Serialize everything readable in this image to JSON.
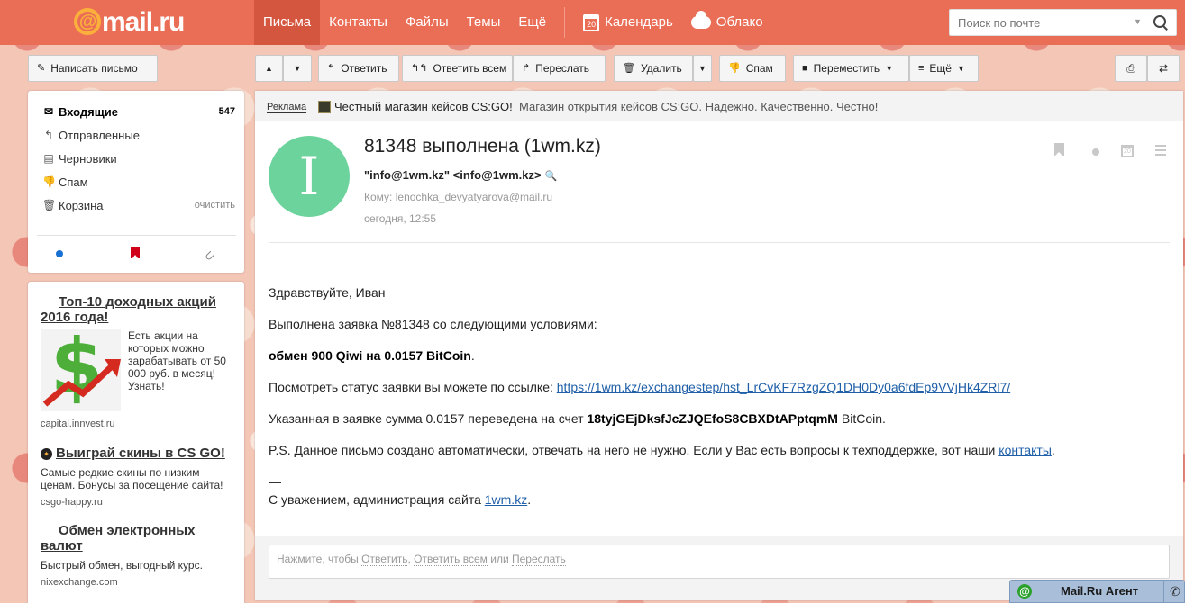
{
  "header": {
    "logo": "mail.ru",
    "nav": [
      "Письма",
      "Контакты",
      "Файлы",
      "Темы",
      "Ещё"
    ],
    "calendar": "Календарь",
    "calendar_day": "20",
    "cloud": "Облако",
    "search_placeholder": "Поиск по почте"
  },
  "toolbar": {
    "compose": "Написать письмо",
    "reply": "Ответить",
    "reply_all": "Ответить всем",
    "forward": "Переслать",
    "delete": "Удалить",
    "spam": "Спам",
    "move": "Переместить",
    "more": "Ещё"
  },
  "folders": [
    {
      "label": "Входящие",
      "count": "547"
    },
    {
      "label": "Отправленные"
    },
    {
      "label": "Черновики"
    },
    {
      "label": "Спам"
    },
    {
      "label": "Корзина",
      "action": "очистить"
    }
  ],
  "ads": [
    {
      "title": "Топ-10 доходных акций 2016 года!",
      "text": "Есть акции на которых можно зарабатывать от 50 000 руб. в месяц! Узнать!",
      "source": "capital.innvest.ru"
    },
    {
      "title": "Выиграй скины в CS GO!",
      "text": "Самые редкие скины по низким ценам. Бонусы за посещение сайта!",
      "source": "csgo-happy.ru"
    },
    {
      "title": "Обмен электронных валют",
      "text": "Быстрый обмен, выгодный курс.",
      "source": "nixexchange.com"
    }
  ],
  "adbar": {
    "label": "Реклама",
    "link": "Честный магазин кейсов CS:GO!",
    "desc": "Магазин открытия кейсов CS:GO. Надежно. Качественно. Честно!"
  },
  "message": {
    "avatar": "I",
    "subject": "81348 выполнена (1wm.kz)",
    "from": "\"info@1wm.kz\" <info@1wm.kz>",
    "to_label": "Кому:",
    "to": "lenochka_devyatyarova@mail.ru",
    "date": "сегодня, 12:55",
    "date_icon_day": "20",
    "greeting": "Здравствуйте, Иван",
    "line1": "Выполнена заявка №81348 со следующими условиями:",
    "line2": "обмен 900 Qiwi на 0.0157 BitCoin",
    "line3_pre": "Посмотреть статус заявки вы можете по ссылке: ",
    "line3_link": "https://1wm.kz/exchangestep/hst_LrCvKF7RzgZQ1DH0Dy0a6fdEp9VVjHk4ZRl7/",
    "line4_pre": "Указанная в заявке сумма 0.0157 переведена на счет ",
    "line4_account": "18tyjGEjDksfJcZJQEfoS8CBXDtAPptqmM",
    "line4_post": " BitCoin.",
    "line5_pre": "P.S. Данное письмо создано автоматически, отвечать на него не нужно. Если у Вас есть вопросы к техподдержке, вот наши ",
    "line5_link": "контакты",
    "dash": "—",
    "sign_pre": "С уважением, администрация сайта ",
    "sign_link": "1wm.kz"
  },
  "reply": {
    "pre": "Нажмите, чтобы ",
    "reply": "Ответить",
    "reply_all": "Ответить всем",
    "or": " или ",
    "forward": "Переслать"
  },
  "agent": {
    "label": "Mail.Ru Агент"
  },
  "colors": {
    "header": "#ea6d56",
    "avatar": "#6dd39c",
    "link": "#1f5fa8"
  }
}
